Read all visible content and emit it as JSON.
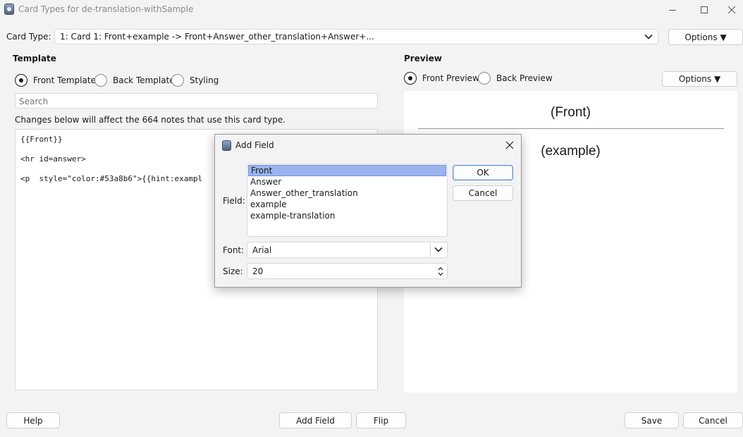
{
  "window": {
    "title": "Card Types for de-translation-withSample"
  },
  "card_type": {
    "label": "Card Type:",
    "selected": "1: Card 1: Front+example -> Front+Answer_other_translation+Answer+...",
    "options_label": "Options ▼"
  },
  "template": {
    "heading": "Template",
    "radios": [
      {
        "label": "Front Template",
        "checked": true
      },
      {
        "label": "Back Template",
        "checked": false
      },
      {
        "label": "Styling",
        "checked": false
      }
    ],
    "search_placeholder": "Search",
    "note": "Changes below will affect the 664 notes that use this card type.",
    "lines": [
      "{{Front}}",
      "<hr id=answer>",
      "<p  style=\"color:#53a8b6\">{{hint:exampl"
    ]
  },
  "preview": {
    "heading": "Preview",
    "radios": [
      {
        "label": "Front Preview",
        "checked": true
      },
      {
        "label": "Back Preview",
        "checked": false
      }
    ],
    "options_label": "Options ▼",
    "front_text": "(Front)",
    "example_text": "(example)"
  },
  "dialog": {
    "title": "Add Field",
    "field_label": "Field:",
    "fields": [
      "Front",
      "Answer",
      "Answer_other_translation",
      "example",
      "example-translation"
    ],
    "selected_index": 0,
    "ok_label": "OK",
    "cancel_label": "Cancel",
    "font_label": "Font:",
    "font_value": "Arial",
    "size_label": "Size:",
    "size_value": "20"
  },
  "footer": {
    "help": "Help",
    "add_field": "Add Field",
    "flip": "Flip",
    "save": "Save",
    "cancel": "Cancel"
  }
}
